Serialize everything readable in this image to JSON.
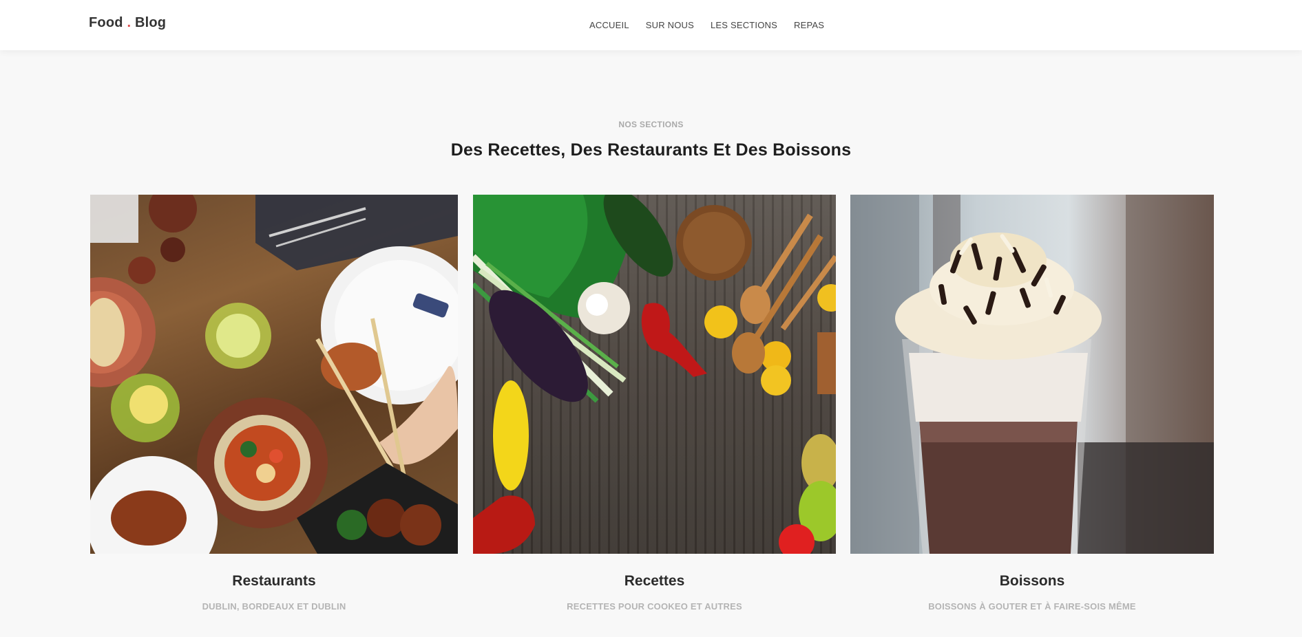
{
  "header": {
    "brand_first": "Food",
    "brand_dot": ".",
    "brand_second": "Blog",
    "nav": [
      "ACCUEIL",
      "SUR NOUS",
      "LES SECTIONS",
      "REPAS"
    ]
  },
  "section": {
    "eyebrow": "NOS SECTIONS",
    "title": "Des Recettes, Des Restaurants Et Des Boissons"
  },
  "cards": [
    {
      "title": "Restaurants",
      "subtitle": "DUBLIN, BORDEAUX ET DUBLIN"
    },
    {
      "title": "Recettes",
      "subtitle": "RECETTES POUR COOKEO ET AUTRES"
    },
    {
      "title": "Boissons",
      "subtitle": "BOISSONS À GOUTER ET À FAIRE-SOIS MÊME"
    }
  ],
  "colors": {
    "accent": "#e04e4e",
    "background": "#f8f8f8"
  }
}
